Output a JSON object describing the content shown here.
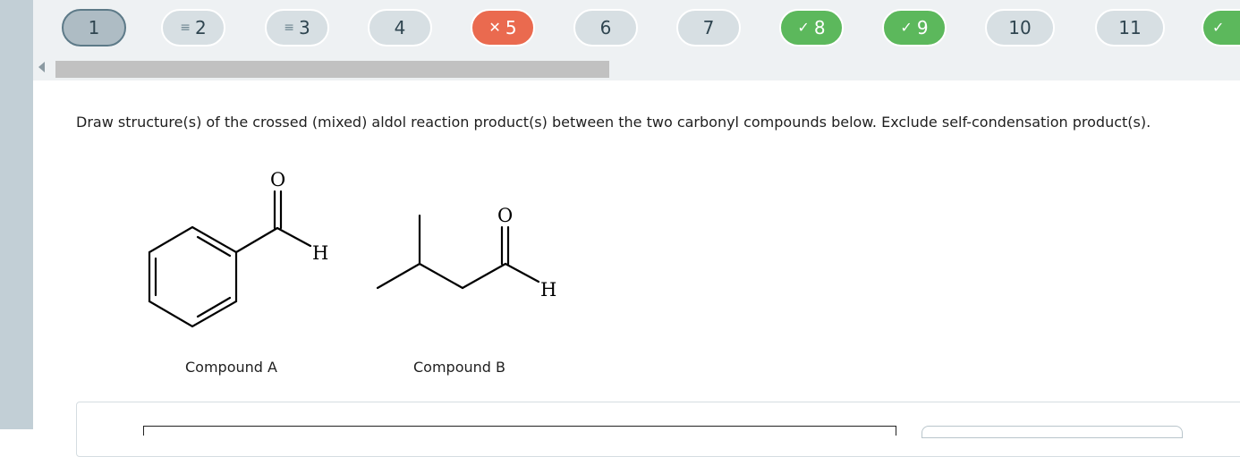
{
  "navigation": {
    "questions": [
      {
        "label": "1",
        "state": "current",
        "mark": ""
      },
      {
        "label": "2",
        "state": "attempted",
        "mark": "lines"
      },
      {
        "label": "3",
        "state": "attempted",
        "mark": "lines"
      },
      {
        "label": "4",
        "state": "unanswered",
        "mark": ""
      },
      {
        "label": "5",
        "state": "wrong",
        "mark": "✕"
      },
      {
        "label": "6",
        "state": "unanswered",
        "mark": ""
      },
      {
        "label": "7",
        "state": "unanswered",
        "mark": ""
      },
      {
        "label": "8",
        "state": "correct",
        "mark": "✓"
      },
      {
        "label": "9",
        "state": "correct",
        "mark": "✓"
      },
      {
        "label": "10",
        "state": "unanswered",
        "mark": ""
      },
      {
        "label": "11",
        "state": "unanswered",
        "mark": ""
      },
      {
        "label": "",
        "state": "correct",
        "mark": "✓"
      }
    ]
  },
  "question": {
    "text": "Draw structure(s) of the crossed (mixed) aldol reaction product(s) between the two carbonyl compounds below. Exclude self-condensation product(s)."
  },
  "compounds": [
    {
      "caption": "Compound A",
      "atoms": [
        "O",
        "H"
      ]
    },
    {
      "caption": "Compound B",
      "atoms": [
        "O",
        "H"
      ]
    }
  ],
  "colors": {
    "correct": "#5cb85c",
    "wrong": "#ea6a4f",
    "current_border": "#5d7a88"
  }
}
